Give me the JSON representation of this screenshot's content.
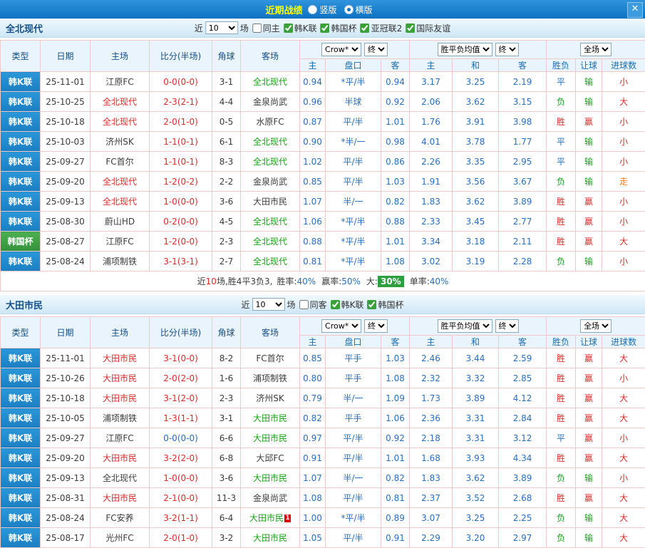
{
  "topbar": {
    "title": "近期战绩",
    "close_icon": "✕",
    "radios": [
      {
        "label": "竖版",
        "checked": false
      },
      {
        "label": "横版",
        "checked": true
      }
    ]
  },
  "sections": [
    {
      "team": "全北现代",
      "controls": {
        "prefix": "近",
        "count": "10",
        "suffix": "场",
        "checkboxes": [
          {
            "label": "同主",
            "checked": false
          },
          {
            "label": "韩K联",
            "checked": true
          },
          {
            "label": "韩国杯",
            "checked": true
          },
          {
            "label": "亚冠联2",
            "checked": true
          },
          {
            "label": "国际友谊",
            "checked": true
          }
        ]
      },
      "header": {
        "cols": [
          "类型",
          "日期",
          "主场",
          "比分(半场)",
          "角球",
          "客场"
        ],
        "selects": {
          "odds_source": "Crow*",
          "final_a": "终",
          "wdl": "胜平负均值",
          "final_b": "终",
          "scope": "全场"
        },
        "sub": [
          "主",
          "盘口",
          "客",
          "主",
          "和",
          "客",
          "胜负",
          "让球",
          "进球数"
        ]
      },
      "rows": [
        {
          "league": "韩K联",
          "league_cls": "blue",
          "date": "25-11-01",
          "home": "江原FC",
          "home_cls": "team-other",
          "score": "0-0(0-0)",
          "score_cls": "c-red",
          "corner": "3-1",
          "away": "全北现代",
          "away_cls": "team-away-focus",
          "odds_h": "0.94",
          "handicap": "*平/半",
          "odds_a": "0.94",
          "w": "3.17",
          "d": "3.25",
          "l": "2.19",
          "res": "平",
          "res_cls": "c-blue",
          "hcp": "输",
          "hcp_cls": "c-green",
          "goal": "小",
          "goal_cls": "c-red"
        },
        {
          "league": "韩K联",
          "league_cls": "blue",
          "date": "25-10-25",
          "home": "全北现代",
          "home_cls": "team-home-focus",
          "score": "2-3(2-1)",
          "score_cls": "c-red",
          "corner": "4-4",
          "away": "金泉尚武",
          "away_cls": "team-other",
          "odds_h": "0.96",
          "handicap": "半球",
          "odds_a": "0.92",
          "w": "2.06",
          "d": "3.62",
          "l": "3.15",
          "res": "负",
          "res_cls": "c-green",
          "hcp": "输",
          "hcp_cls": "c-green",
          "goal": "大",
          "goal_cls": "c-red"
        },
        {
          "league": "韩K联",
          "league_cls": "blue",
          "date": "25-10-18",
          "home": "全北现代",
          "home_cls": "team-home-focus",
          "score": "2-0(1-0)",
          "score_cls": "c-red",
          "corner": "0-5",
          "away": "水原FC",
          "away_cls": "team-other",
          "odds_h": "0.87",
          "handicap": "平/半",
          "odds_a": "1.01",
          "w": "1.76",
          "d": "3.91",
          "l": "3.98",
          "res": "胜",
          "res_cls": "c-red",
          "hcp": "赢",
          "hcp_cls": "c-red",
          "goal": "小",
          "goal_cls": "c-red"
        },
        {
          "league": "韩K联",
          "league_cls": "blue",
          "date": "25-10-03",
          "home": "济州SK",
          "home_cls": "team-other",
          "score": "1-1(0-1)",
          "score_cls": "c-red",
          "corner": "6-1",
          "away": "全北现代",
          "away_cls": "team-away-focus",
          "odds_h": "0.90",
          "handicap": "*半/一",
          "odds_a": "0.98",
          "w": "4.01",
          "d": "3.78",
          "l": "1.77",
          "res": "平",
          "res_cls": "c-blue",
          "hcp": "输",
          "hcp_cls": "c-green",
          "goal": "小",
          "goal_cls": "c-red"
        },
        {
          "league": "韩K联",
          "league_cls": "blue",
          "date": "25-09-27",
          "home": "FC首尔",
          "home_cls": "team-other",
          "score": "1-1(0-1)",
          "score_cls": "c-red",
          "corner": "8-3",
          "away": "全北现代",
          "away_cls": "team-away-focus",
          "odds_h": "1.02",
          "handicap": "平/半",
          "odds_a": "0.86",
          "w": "2.26",
          "d": "3.35",
          "l": "2.95",
          "res": "平",
          "res_cls": "c-blue",
          "hcp": "输",
          "hcp_cls": "c-green",
          "goal": "小",
          "goal_cls": "c-red"
        },
        {
          "league": "韩K联",
          "league_cls": "blue",
          "date": "25-09-20",
          "home": "全北现代",
          "home_cls": "team-home-focus",
          "score": "1-2(0-2)",
          "score_cls": "c-red",
          "corner": "2-2",
          "away": "金泉尚武",
          "away_cls": "team-other",
          "odds_h": "0.85",
          "handicap": "平/半",
          "odds_a": "1.03",
          "w": "1.91",
          "d": "3.56",
          "l": "3.67",
          "res": "负",
          "res_cls": "c-green",
          "hcp": "输",
          "hcp_cls": "c-green",
          "goal": "走",
          "goal_cls": "c-orange"
        },
        {
          "league": "韩K联",
          "league_cls": "blue",
          "date": "25-09-13",
          "home": "全北现代",
          "home_cls": "team-home-focus",
          "score": "1-0(0-0)",
          "score_cls": "c-red",
          "corner": "3-6",
          "away": "大田市民",
          "away_cls": "team-other",
          "odds_h": "1.07",
          "handicap": "半/一",
          "odds_a": "0.82",
          "w": "1.83",
          "d": "3.62",
          "l": "3.89",
          "res": "胜",
          "res_cls": "c-red",
          "hcp": "赢",
          "hcp_cls": "c-red",
          "goal": "小",
          "goal_cls": "c-red"
        },
        {
          "league": "韩K联",
          "league_cls": "blue",
          "date": "25-08-30",
          "home": "蔚山HD",
          "home_cls": "team-other",
          "score": "0-2(0-0)",
          "score_cls": "c-red",
          "corner": "4-5",
          "away": "全北现代",
          "away_cls": "team-away-focus",
          "odds_h": "1.06",
          "handicap": "*平/半",
          "odds_a": "0.88",
          "w": "2.33",
          "d": "3.45",
          "l": "2.77",
          "res": "胜",
          "res_cls": "c-red",
          "hcp": "赢",
          "hcp_cls": "c-red",
          "goal": "小",
          "goal_cls": "c-red"
        },
        {
          "league": "韩国杯",
          "league_cls": "green",
          "date": "25-08-27",
          "home": "江原FC",
          "home_cls": "team-other",
          "score": "1-2(0-0)",
          "score_cls": "c-red",
          "corner": "2-3",
          "away": "全北现代",
          "away_cls": "team-away-focus",
          "odds_h": "0.88",
          "handicap": "*平/半",
          "odds_a": "1.01",
          "w": "3.34",
          "d": "3.18",
          "l": "2.11",
          "res": "胜",
          "res_cls": "c-red",
          "hcp": "赢",
          "hcp_cls": "c-red",
          "goal": "大",
          "goal_cls": "c-red"
        },
        {
          "league": "韩K联",
          "league_cls": "blue",
          "date": "25-08-24",
          "home": "浦项制铁",
          "home_cls": "team-other",
          "score": "3-1(3-1)",
          "score_cls": "c-red",
          "corner": "2-7",
          "away": "全北现代",
          "away_cls": "team-away-focus",
          "odds_h": "0.81",
          "handicap": "*平/半",
          "odds_a": "1.08",
          "w": "3.02",
          "d": "3.19",
          "l": "2.28",
          "res": "负",
          "res_cls": "c-green",
          "hcp": "输",
          "hcp_cls": "c-green",
          "goal": "小",
          "goal_cls": "c-red"
        }
      ],
      "summary": {
        "prefix": "近",
        "count": "10",
        "mid": "场,胜4平3负3,",
        "win_label": "胜率:",
        "win": "40%",
        "hcp_label": "赢率:",
        "hcp": "50%",
        "big_label": "大:",
        "big": "30%",
        "single_label": "单率:",
        "single": "40%"
      }
    },
    {
      "team": "大田市民",
      "controls": {
        "prefix": "近",
        "count": "10",
        "suffix": "场",
        "checkboxes": [
          {
            "label": "同客",
            "checked": false
          },
          {
            "label": "韩K联",
            "checked": true
          },
          {
            "label": "韩国杯",
            "checked": true
          }
        ]
      },
      "header": {
        "cols": [
          "类型",
          "日期",
          "主场",
          "比分(半场)",
          "角球",
          "客场"
        ],
        "selects": {
          "odds_source": "Crow*",
          "final_a": "终",
          "wdl": "胜平负均值",
          "final_b": "终",
          "scope": "全场"
        },
        "sub": [
          "主",
          "盘口",
          "客",
          "主",
          "和",
          "客",
          "胜负",
          "让球",
          "进球数"
        ]
      },
      "rows": [
        {
          "league": "韩K联",
          "league_cls": "blue",
          "date": "25-11-01",
          "home": "大田市民",
          "home_cls": "team-home-focus",
          "score": "3-1(0-0)",
          "score_cls": "c-red",
          "corner": "8-2",
          "away": "FC首尔",
          "away_cls": "team-other",
          "odds_h": "0.85",
          "handicap": "平手",
          "odds_a": "1.03",
          "w": "2.46",
          "d": "3.44",
          "l": "2.59",
          "res": "胜",
          "res_cls": "c-red",
          "hcp": "赢",
          "hcp_cls": "c-red",
          "goal": "大",
          "goal_cls": "c-red"
        },
        {
          "league": "韩K联",
          "league_cls": "blue",
          "date": "25-10-26",
          "home": "大田市民",
          "home_cls": "team-home-focus",
          "score": "2-0(2-0)",
          "score_cls": "c-red",
          "corner": "1-6",
          "away": "浦项制铁",
          "away_cls": "team-other",
          "odds_h": "0.80",
          "handicap": "平手",
          "odds_a": "1.08",
          "w": "2.32",
          "d": "3.32",
          "l": "2.85",
          "res": "胜",
          "res_cls": "c-red",
          "hcp": "赢",
          "hcp_cls": "c-red",
          "goal": "小",
          "goal_cls": "c-red"
        },
        {
          "league": "韩K联",
          "league_cls": "blue",
          "date": "25-10-18",
          "home": "大田市民",
          "home_cls": "team-home-focus",
          "score": "3-1(2-0)",
          "score_cls": "c-red",
          "corner": "2-3",
          "away": "济州SK",
          "away_cls": "team-other",
          "odds_h": "0.79",
          "handicap": "半/一",
          "odds_a": "1.09",
          "w": "1.73",
          "d": "3.89",
          "l": "4.12",
          "res": "胜",
          "res_cls": "c-red",
          "hcp": "赢",
          "hcp_cls": "c-red",
          "goal": "大",
          "goal_cls": "c-red"
        },
        {
          "league": "韩K联",
          "league_cls": "blue",
          "date": "25-10-05",
          "home": "浦项制铁",
          "home_cls": "team-other",
          "score": "1-3(1-1)",
          "score_cls": "c-red",
          "corner": "3-1",
          "away": "大田市民",
          "away_cls": "team-away-focus",
          "odds_h": "0.82",
          "handicap": "平手",
          "odds_a": "1.06",
          "w": "2.36",
          "d": "3.31",
          "l": "2.84",
          "res": "胜",
          "res_cls": "c-red",
          "hcp": "赢",
          "hcp_cls": "c-red",
          "goal": "大",
          "goal_cls": "c-red"
        },
        {
          "league": "韩K联",
          "league_cls": "blue",
          "date": "25-09-27",
          "home": "江原FC",
          "home_cls": "team-other",
          "score": "0-0(0-0)",
          "score_cls": "c-blue",
          "corner": "6-6",
          "away": "大田市民",
          "away_cls": "team-away-focus",
          "odds_h": "0.97",
          "handicap": "平/半",
          "odds_a": "0.92",
          "w": "2.18",
          "d": "3.31",
          "l": "3.12",
          "res": "平",
          "res_cls": "c-blue",
          "hcp": "赢",
          "hcp_cls": "c-red",
          "goal": "小",
          "goal_cls": "c-red"
        },
        {
          "league": "韩K联",
          "league_cls": "blue",
          "date": "25-09-20",
          "home": "大田市民",
          "home_cls": "team-home-focus",
          "score": "3-2(2-0)",
          "score_cls": "c-red",
          "corner": "6-8",
          "away": "大邱FC",
          "away_cls": "team-other",
          "odds_h": "0.91",
          "handicap": "平/半",
          "odds_a": "1.01",
          "w": "1.68",
          "d": "3.93",
          "l": "4.34",
          "res": "胜",
          "res_cls": "c-red",
          "hcp": "赢",
          "hcp_cls": "c-red",
          "goal": "大",
          "goal_cls": "c-red"
        },
        {
          "league": "韩K联",
          "league_cls": "blue",
          "date": "25-09-13",
          "home": "全北现代",
          "home_cls": "team-other",
          "score": "1-0(0-0)",
          "score_cls": "c-red",
          "corner": "3-6",
          "away": "大田市民",
          "away_cls": "team-away-focus",
          "odds_h": "1.07",
          "handicap": "半/一",
          "odds_a": "0.82",
          "w": "1.83",
          "d": "3.62",
          "l": "3.89",
          "res": "负",
          "res_cls": "c-green",
          "hcp": "输",
          "hcp_cls": "c-green",
          "goal": "小",
          "goal_cls": "c-red"
        },
        {
          "league": "韩K联",
          "league_cls": "blue",
          "date": "25-08-31",
          "home": "大田市民",
          "home_cls": "team-home-focus",
          "score": "2-1(0-0)",
          "score_cls": "c-red",
          "corner": "11-3",
          "away": "金泉尚武",
          "away_cls": "team-other",
          "odds_h": "1.08",
          "handicap": "平/半",
          "odds_a": "0.81",
          "w": "2.37",
          "d": "3.52",
          "l": "2.68",
          "res": "胜",
          "res_cls": "c-red",
          "hcp": "赢",
          "hcp_cls": "c-red",
          "goal": "大",
          "goal_cls": "c-red"
        },
        {
          "league": "韩K联",
          "league_cls": "blue",
          "date": "25-08-24",
          "home": "FC安养",
          "home_cls": "team-other",
          "score": "3-2(1-1)",
          "score_cls": "c-red",
          "corner": "6-4",
          "away": "大田市民",
          "away_cls": "team-away-focus",
          "away_badge": "1",
          "odds_h": "1.00",
          "handicap": "*平/半",
          "odds_a": "0.89",
          "w": "3.07",
          "d": "3.25",
          "l": "2.25",
          "res": "负",
          "res_cls": "c-green",
          "hcp": "输",
          "hcp_cls": "c-green",
          "goal": "大",
          "goal_cls": "c-red"
        },
        {
          "league": "韩K联",
          "league_cls": "blue",
          "date": "25-08-17",
          "home": "光州FC",
          "home_cls": "team-other",
          "score": "2-0(1-0)",
          "score_cls": "c-red",
          "corner": "3-2",
          "away": "大田市民",
          "away_cls": "team-away-focus",
          "odds_h": "1.05",
          "handicap": "平/半",
          "odds_a": "0.91",
          "w": "2.29",
          "d": "3.20",
          "l": "2.97",
          "res": "负",
          "res_cls": "c-green",
          "hcp": "输",
          "hcp_cls": "c-green",
          "goal": "大",
          "goal_cls": "c-red"
        }
      ],
      "summary": null
    }
  ]
}
